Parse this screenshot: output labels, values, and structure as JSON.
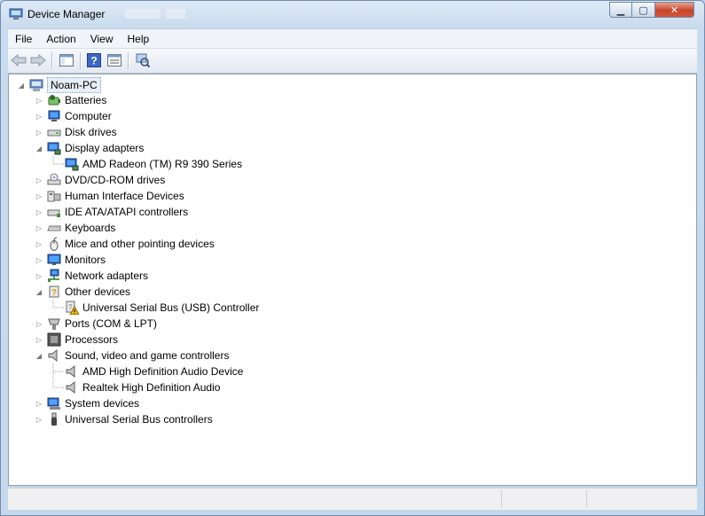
{
  "window": {
    "title": "Device Manager"
  },
  "menu": [
    "File",
    "Action",
    "View",
    "Help"
  ],
  "toolbar": {
    "buttons": [
      "back-arrow-icon",
      "forward-arrow-icon",
      "show-hide-console-tree-icon",
      "help-icon",
      "properties-icon",
      "scan-hardware-icon"
    ]
  },
  "tree": {
    "root": "Noam-PC",
    "categories": [
      {
        "label": "Batteries",
        "icon": "battery-icon",
        "expanded": false
      },
      {
        "label": "Computer",
        "icon": "computer-icon",
        "expanded": false
      },
      {
        "label": "Disk drives",
        "icon": "disk-drive-icon",
        "expanded": false
      },
      {
        "label": "Display adapters",
        "icon": "display-adapter-icon",
        "expanded": true,
        "children": [
          {
            "label": "AMD Radeon (TM) R9 390 Series",
            "icon": "display-adapter-icon"
          }
        ]
      },
      {
        "label": "DVD/CD-ROM drives",
        "icon": "dvd-drive-icon",
        "expanded": false
      },
      {
        "label": "Human Interface Devices",
        "icon": "hid-icon",
        "expanded": false
      },
      {
        "label": "IDE ATA/ATAPI controllers",
        "icon": "ide-controller-icon",
        "expanded": false
      },
      {
        "label": "Keyboards",
        "icon": "keyboard-icon",
        "expanded": false
      },
      {
        "label": "Mice and other pointing devices",
        "icon": "mouse-icon",
        "expanded": false
      },
      {
        "label": "Monitors",
        "icon": "monitor-icon",
        "expanded": false
      },
      {
        "label": "Network adapters",
        "icon": "network-adapter-icon",
        "expanded": false
      },
      {
        "label": "Other devices",
        "icon": "other-device-icon",
        "expanded": true,
        "children": [
          {
            "label": "Universal Serial Bus (USB) Controller",
            "icon": "warning-device-icon"
          }
        ]
      },
      {
        "label": "Ports (COM & LPT)",
        "icon": "port-icon",
        "expanded": false
      },
      {
        "label": "Processors",
        "icon": "processor-icon",
        "expanded": false
      },
      {
        "label": "Sound, video and game controllers",
        "icon": "speaker-icon",
        "expanded": true,
        "children": [
          {
            "label": "AMD High Definition Audio Device",
            "icon": "speaker-icon"
          },
          {
            "label": "Realtek High Definition Audio",
            "icon": "speaker-icon"
          }
        ]
      },
      {
        "label": "System devices",
        "icon": "system-device-icon",
        "expanded": false
      },
      {
        "label": "Universal Serial Bus controllers",
        "icon": "usb-icon",
        "expanded": false
      }
    ]
  },
  "colors": {
    "accent": "#3a6ea5",
    "close_button": "#c7452a",
    "warning": "#f2c200"
  }
}
